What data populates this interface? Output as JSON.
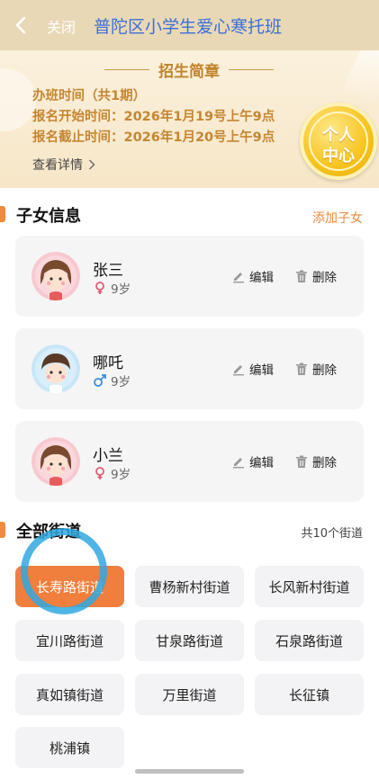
{
  "header": {
    "back_icon": "chevron-left-icon",
    "close_label": "关闭",
    "title": "普陀区小学生爱心寒托班"
  },
  "banner": {
    "heading": "招生简章",
    "session": "办班时间（共1期）",
    "start": "报名开始时间：2026年1月19号上午9点",
    "end": "报名截止时间：2026年1月20号上午9点",
    "details": "查看详情",
    "center_line1": "个人",
    "center_line2": "中心"
  },
  "children_section": {
    "title": "子女信息",
    "add_label": "添加子女",
    "edit_label": "编辑",
    "delete_label": "删除",
    "items": [
      {
        "name": "张三",
        "gender": "female",
        "age": "9岁"
      },
      {
        "name": "哪吒",
        "gender": "male",
        "age": "9岁"
      },
      {
        "name": "小兰",
        "gender": "female",
        "age": "9岁"
      }
    ]
  },
  "streets_section": {
    "title": "全部街道",
    "count": "共10个街道",
    "items": [
      "长寿路街道",
      "曹杨新村街道",
      "长风新村街道",
      "宜川路街道",
      "甘泉路街道",
      "石泉路街道",
      "真如镇街道",
      "万里街道",
      "长征镇",
      "桃浦镇"
    ],
    "selected": "长寿路街道"
  },
  "colors": {
    "accent": "#f08a3e",
    "title_blue": "#3b6fd8",
    "banner_text": "#c58632",
    "male": "#3a8ee0",
    "female": "#e25b74"
  }
}
